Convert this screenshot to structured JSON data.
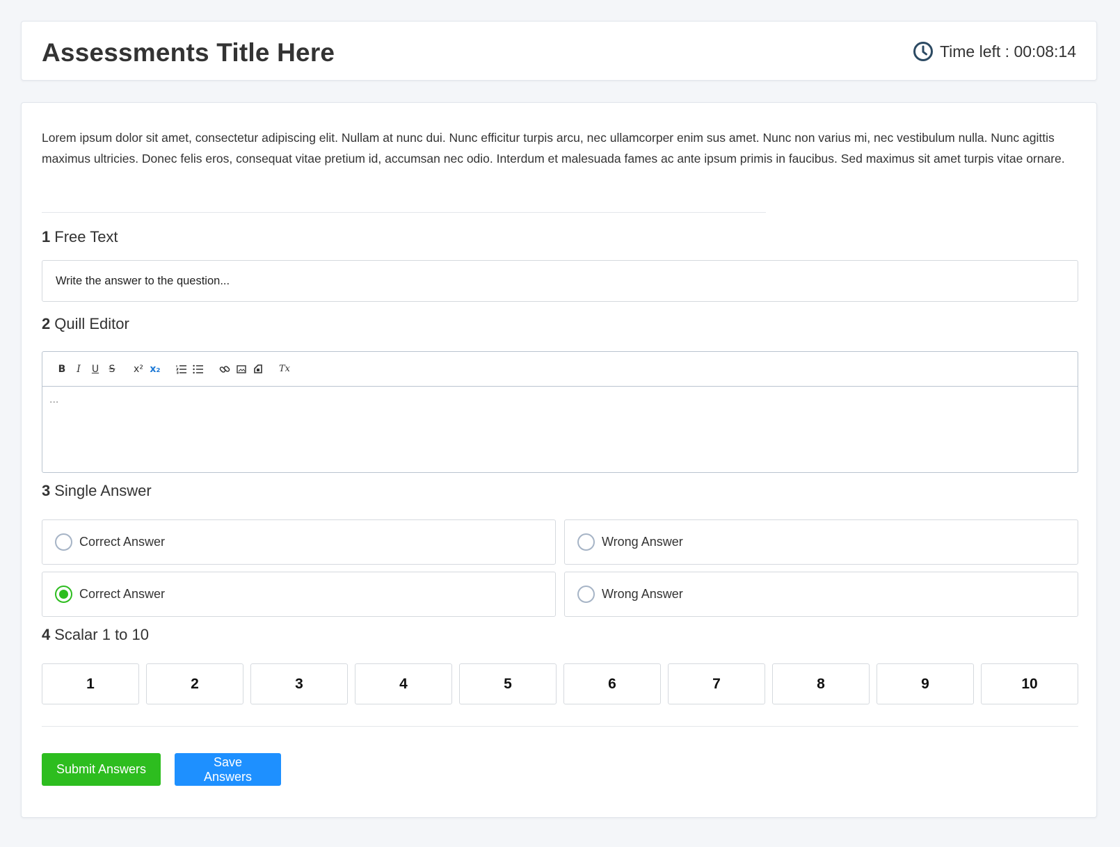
{
  "header": {
    "title": "Assessments Title Here",
    "timer_label": "Time left : 00:08:14",
    "timer_icon": "clock-icon"
  },
  "intro": "Lorem ipsum dolor sit amet, consectetur adipiscing elit. Nullam at nunc dui. Nunc efficitur turpis arcu, nec ullamcorper enim sus amet. Nunc non varius mi, nec vestibulum nulla. Nunc agittis maximus ultricies. Donec felis eros, consequat vitae pretium id, accumsan nec odio. Interdum et malesuada fames ac ante ipsum primis in faucibus. Sed maximus sit amet turpis vitae ornare.",
  "questions": [
    {
      "number": "1",
      "title": "Free Text",
      "placeholder": "Write the answer to the question..."
    },
    {
      "number": "2",
      "title": "Quill Editor",
      "placeholder": "..."
    },
    {
      "number": "3",
      "title": "Single Answer",
      "options": [
        {
          "label": "Correct Answer",
          "checked": false
        },
        {
          "label": "Wrong Answer",
          "checked": false
        },
        {
          "label": "Correct Answer",
          "checked": true
        },
        {
          "label": "Wrong Answer",
          "checked": false
        }
      ]
    },
    {
      "number": "4",
      "title": "Scalar 1 to 10",
      "scale": [
        "1",
        "2",
        "3",
        "4",
        "5",
        "6",
        "7",
        "8",
        "9",
        "10"
      ]
    }
  ],
  "toolbar": {
    "bold": "B",
    "italic": "I",
    "underline": "U",
    "strike": "S",
    "superscript": "x²",
    "subscript": "x₂",
    "ordered_list_icon": "ordered-list-icon",
    "bullet_list_icon": "bullet-list-icon",
    "link_icon": "link-icon",
    "image_icon": "image-icon",
    "video_icon": "video-icon",
    "clean": "Tx"
  },
  "buttons": {
    "submit": "Submit Answers",
    "save": "Save Answers"
  },
  "colors": {
    "accent_green": "#2dbd1f",
    "accent_blue": "#1e90ff",
    "clock": "#2c4a63"
  }
}
